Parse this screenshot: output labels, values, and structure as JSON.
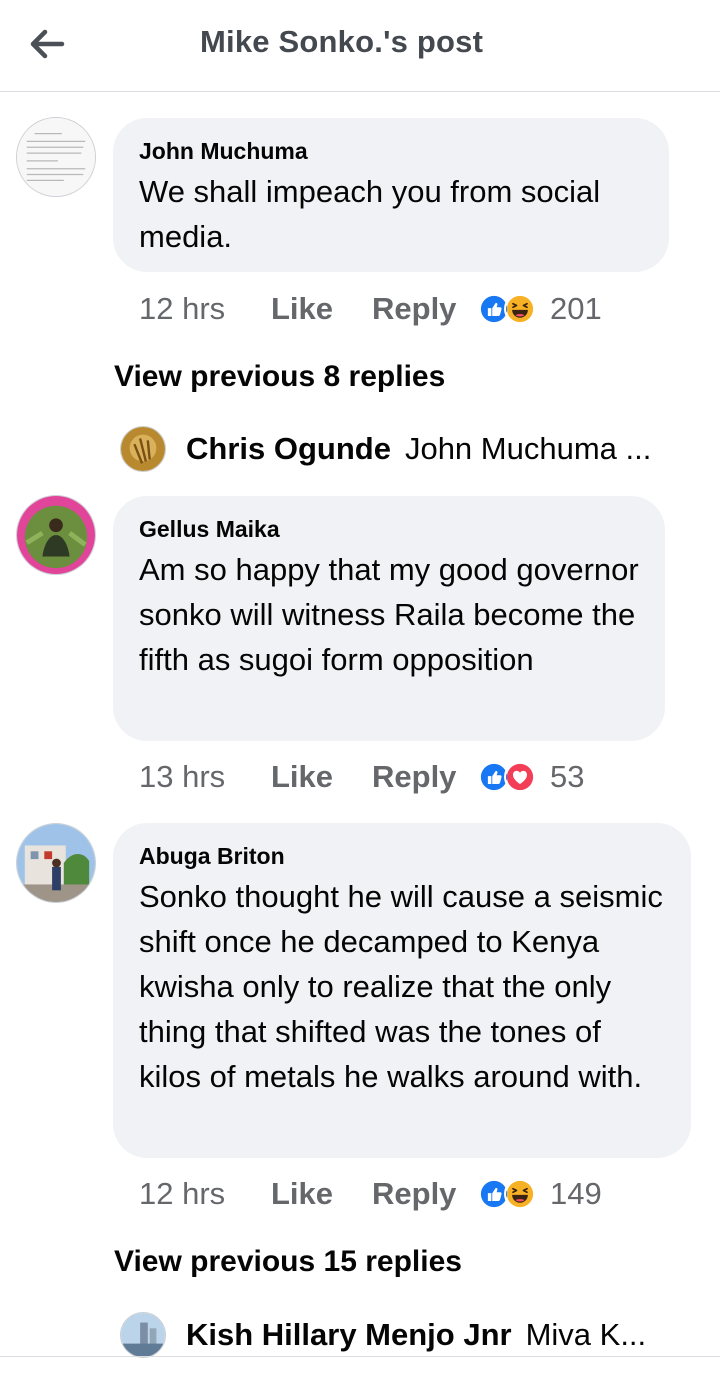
{
  "header": {
    "title": "Mike Sonko.'s post",
    "back_icon": "back-arrow-icon"
  },
  "comments": [
    {
      "author": "John Muchuma",
      "text": "We shall impeach you from social media.",
      "time": "12 hrs",
      "like": "Like",
      "reply": "Reply",
      "reactions": [
        "like",
        "haha"
      ],
      "reaction_count": "201"
    },
    {
      "author": "Gellus Maika",
      "text": "Am so happy that my good governor sonko will witness Raila become the fifth as sugoi form opposition",
      "time": "13 hrs",
      "like": "Like",
      "reply": "Reply",
      "reactions": [
        "like",
        "love"
      ],
      "reaction_count": "53"
    },
    {
      "author": "Abuga Briton",
      "text": "Sonko thought he will cause a seismic shift once he decamped to Kenya kwisha only to realize that the only thing that shifted was the tones of kilos of metals he walks around with.",
      "time": "12 hrs",
      "like": "Like",
      "reply": "Reply",
      "reactions": [
        "like",
        "haha"
      ],
      "reaction_count": "149"
    }
  ],
  "threads": [
    {
      "view_previous": "View previous 8 replies",
      "reply_name": "Chris Ogunde",
      "reply_snippet": "John Muchuma ..."
    },
    {
      "view_previous": "View previous 15 replies",
      "reply_name": "Kish Hillary Menjo Jnr",
      "reply_snippet": "Miva K..."
    }
  ],
  "colors": {
    "like_blue": "#1877f2",
    "haha_yellow": "#f7b125",
    "love_red": "#f33e58",
    "bubble_bg": "#f0f2f5",
    "meta_gray": "#65676b"
  }
}
